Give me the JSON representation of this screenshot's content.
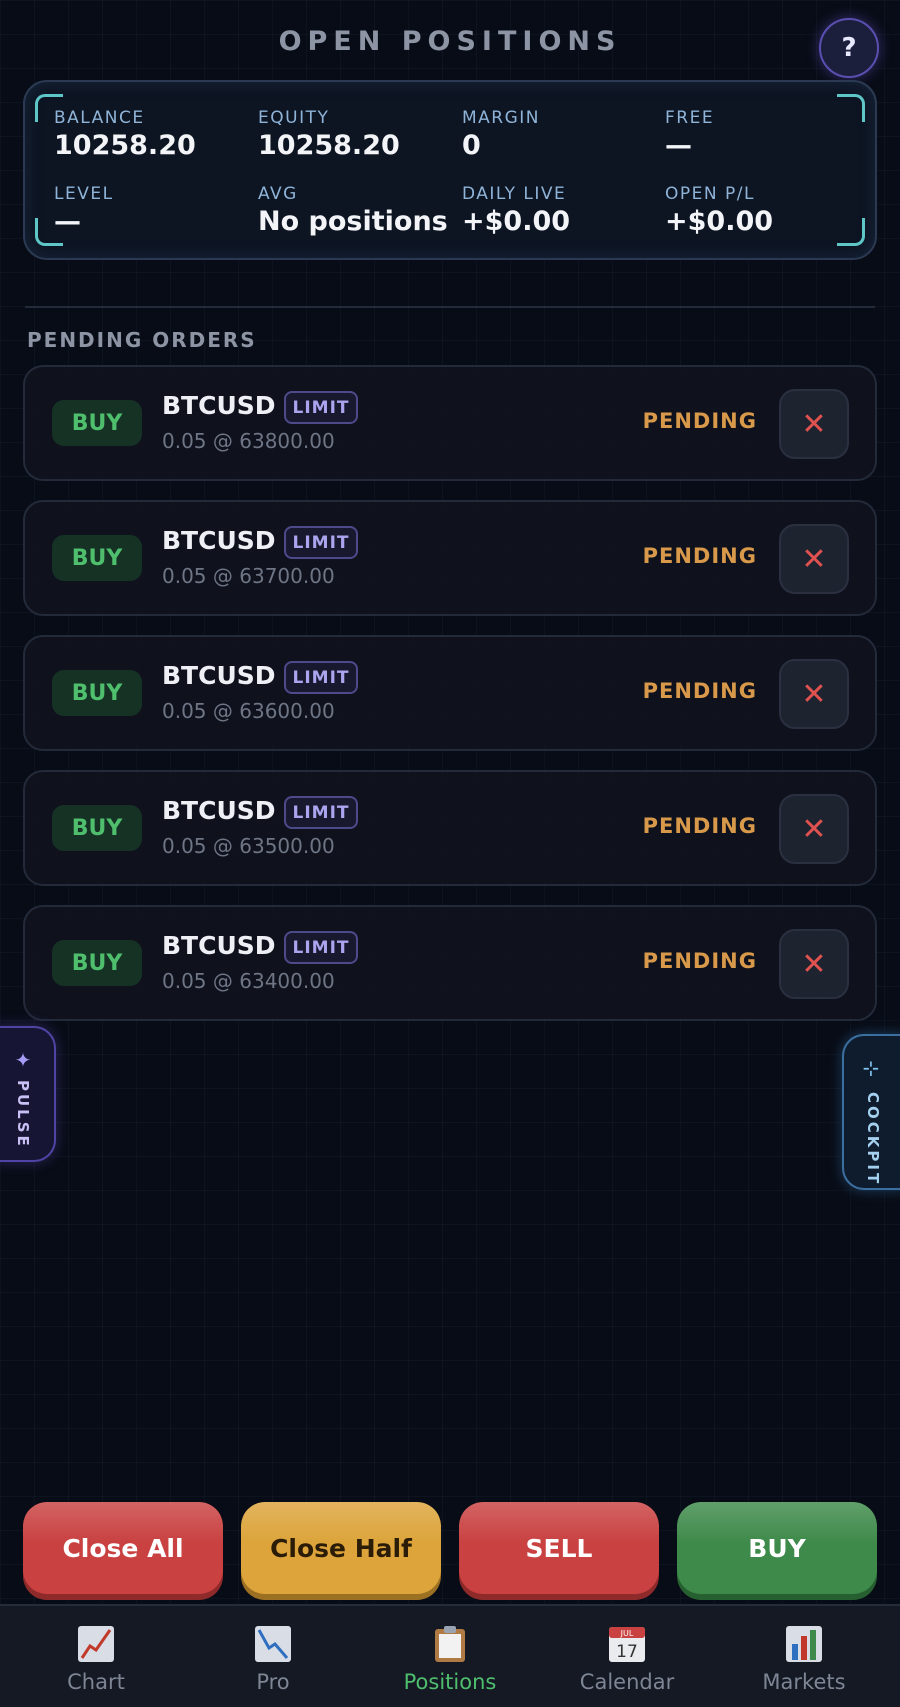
{
  "header": {
    "title": "OPEN POSITIONS",
    "help_label": "?"
  },
  "account": {
    "stats": [
      {
        "label": "BALANCE",
        "value": "10258.20"
      },
      {
        "label": "EQUITY",
        "value": "10258.20"
      },
      {
        "label": "MARGIN",
        "value": "0"
      },
      {
        "label": "FREE",
        "value": "—"
      },
      {
        "label": "LEVEL",
        "value": "—"
      },
      {
        "label": "AVG",
        "value": "No positions"
      },
      {
        "label": "DAILY LIVE",
        "value": "+$0.00"
      },
      {
        "label": "OPEN P/L",
        "value": "+$0.00"
      }
    ]
  },
  "pending": {
    "title": "PENDING ORDERS",
    "orders": [
      {
        "side": "BUY",
        "symbol": "BTCUSD",
        "type": "LIMIT",
        "detail": "0.05 @ 63800.00",
        "status": "PENDING",
        "cancel": "✕"
      },
      {
        "side": "BUY",
        "symbol": "BTCUSD",
        "type": "LIMIT",
        "detail": "0.05 @ 63700.00",
        "status": "PENDING",
        "cancel": "✕"
      },
      {
        "side": "BUY",
        "symbol": "BTCUSD",
        "type": "LIMIT",
        "detail": "0.05 @ 63600.00",
        "status": "PENDING",
        "cancel": "✕"
      },
      {
        "side": "BUY",
        "symbol": "BTCUSD",
        "type": "LIMIT",
        "detail": "0.05 @ 63500.00",
        "status": "PENDING",
        "cancel": "✕"
      },
      {
        "side": "BUY",
        "symbol": "BTCUSD",
        "type": "LIMIT",
        "detail": "0.05 @ 63400.00",
        "status": "PENDING",
        "cancel": "✕"
      }
    ]
  },
  "side_tabs": {
    "left": "PULSE",
    "right": "COCKPIT"
  },
  "actions": {
    "close_all": "Close All",
    "close_half": "Close Half",
    "sell": "SELL",
    "buy": "BUY"
  },
  "nav": {
    "items": [
      {
        "label": "Chart",
        "icon": "chart-line-icon"
      },
      {
        "label": "Pro",
        "icon": "chart-down-icon"
      },
      {
        "label": "Positions",
        "icon": "clipboard-icon",
        "active": true
      },
      {
        "label": "Calendar",
        "icon": "calendar-icon",
        "month": "JUL",
        "day": "17"
      },
      {
        "label": "Markets",
        "icon": "bar-chart-icon"
      }
    ]
  },
  "colors": {
    "background": "#080c16",
    "buy_green": "#4fbf6e",
    "sell_red": "#c94141",
    "pending_orange": "#d8994a",
    "close_half_yellow": "#dca43a",
    "accent_purple": "#5a4fb0",
    "accent_cyan": "#5ec6c7"
  }
}
